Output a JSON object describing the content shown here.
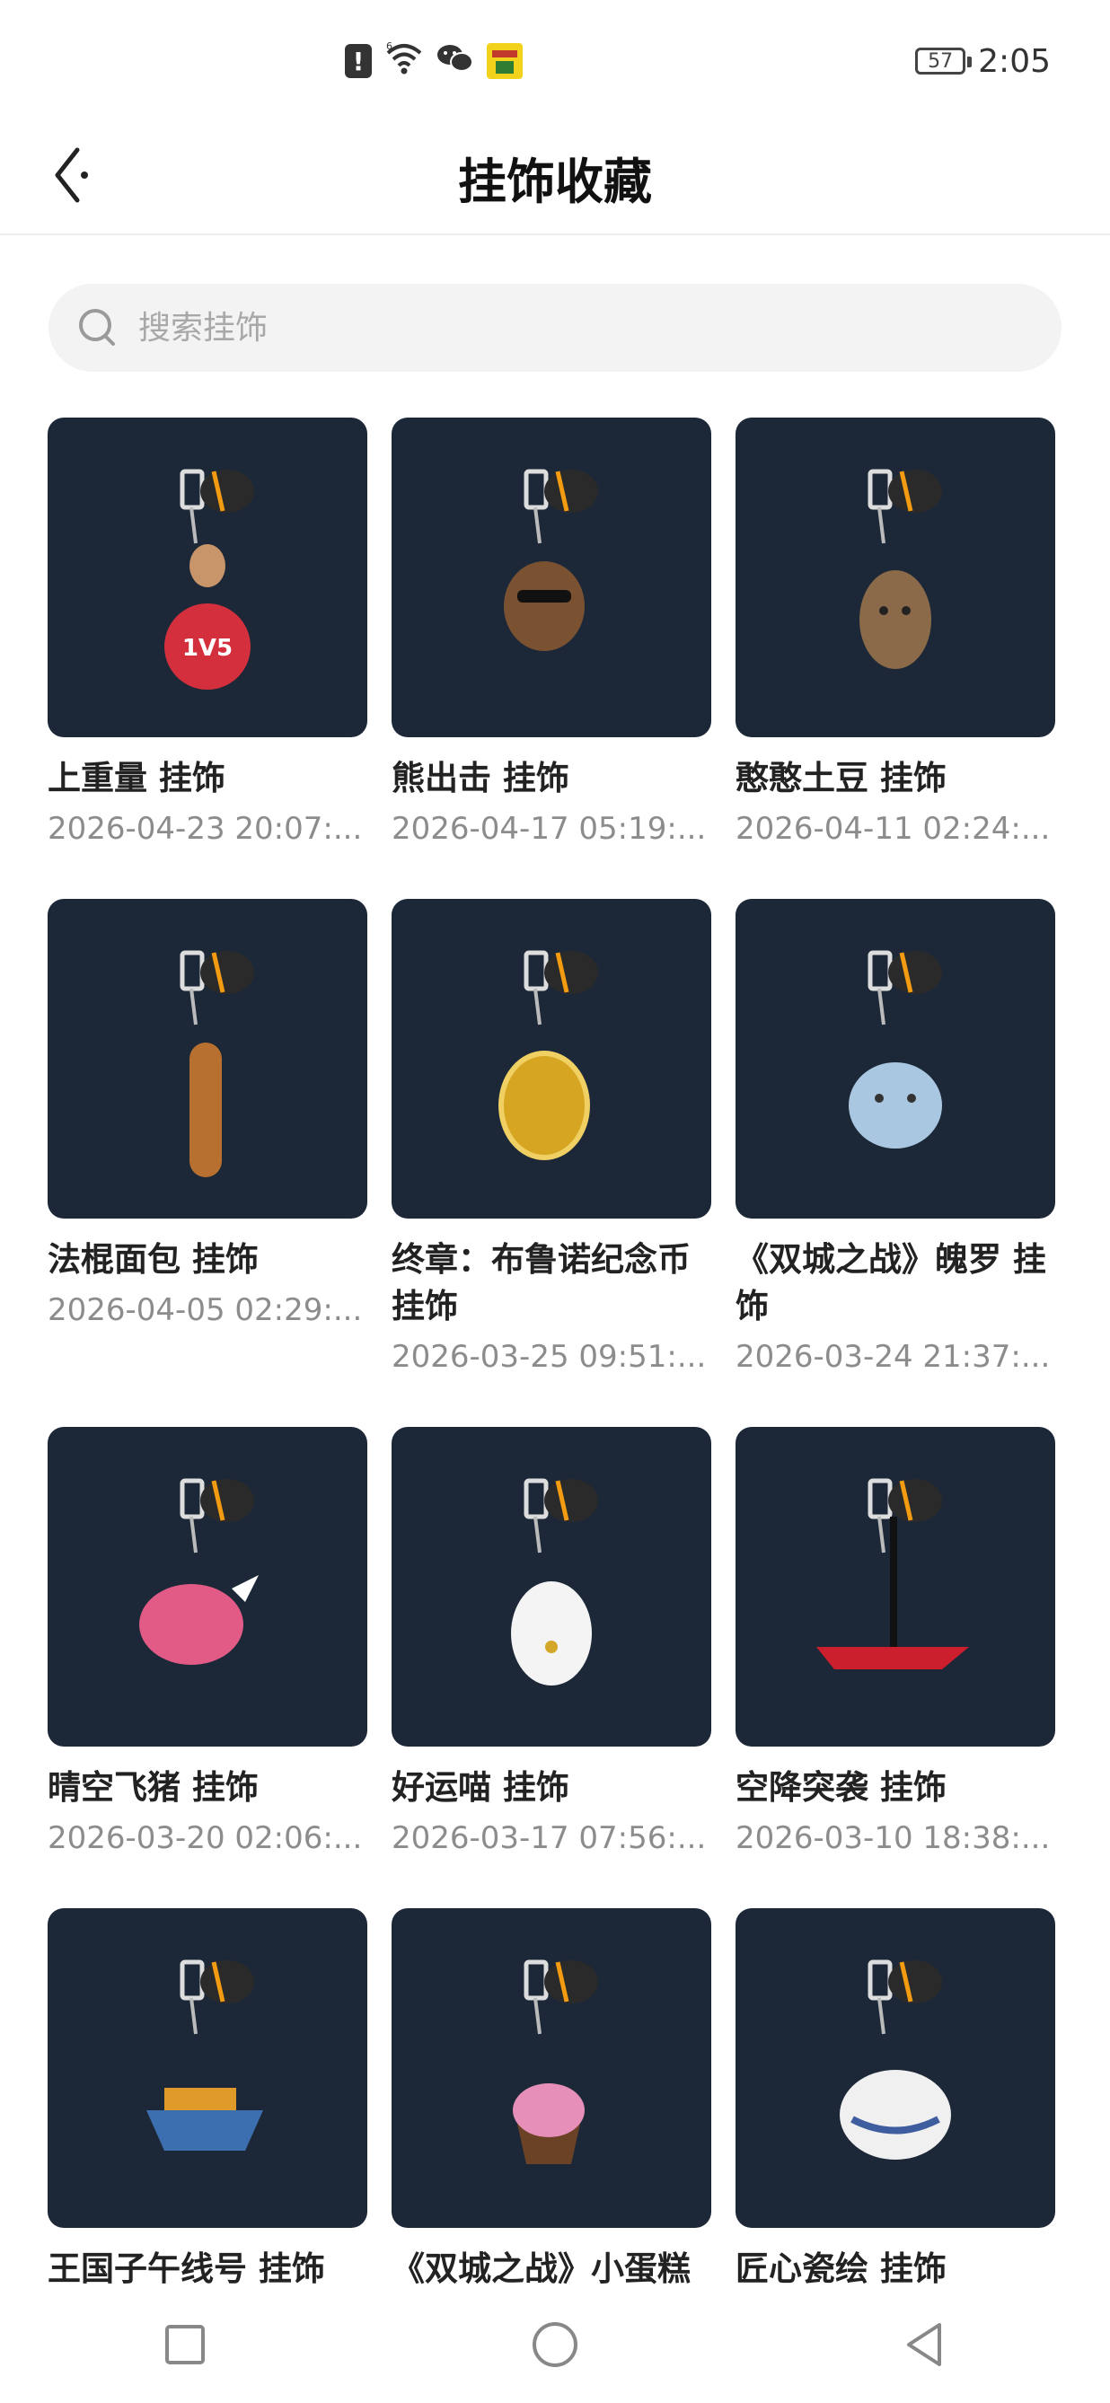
{
  "status_bar": {
    "alert_glyph": "!",
    "network_label": "6",
    "battery_level": "57",
    "time": "2:05"
  },
  "nav": {
    "title": "挂饰收藏"
  },
  "search": {
    "placeholder": "搜索挂饰",
    "value": ""
  },
  "items": [
    {
      "name": " 上重量 挂饰",
      "date": "2026-04-23 20:07:...",
      "icon": "kettlebell-charm",
      "accent": "#d32f3c"
    },
    {
      "name": "熊出击 挂饰",
      "date": "2026-04-17 05:19:...",
      "icon": "bear-charm",
      "accent": "#7a5231"
    },
    {
      "name": "憨憨土豆 挂饰",
      "date": "2026-04-11 02:24:...",
      "icon": "potato-charm",
      "accent": "#8a6a48"
    },
    {
      "name": "法棍面包 挂饰",
      "date": "2026-04-05 02:29:...",
      "icon": "baguette-charm",
      "accent": "#b7702f"
    },
    {
      "name": "终章：布鲁诺纪念币 挂饰",
      "date": "2026-03-25 09:51:...",
      "icon": "coin-charm",
      "accent": "#d6a521"
    },
    {
      "name": "《双城之战》魄罗 挂饰",
      "date": "2026-03-24 21:37:...",
      "icon": "poro-charm",
      "accent": "#a9c7e0"
    },
    {
      "name": "晴空飞猪 挂饰",
      "date": "2026-03-20 02:06:...",
      "icon": "flying-pig-charm",
      "accent": "#e25b86"
    },
    {
      "name": "好运喵 挂饰",
      "date": "2026-03-17 07:56:...",
      "icon": "lucky-cat-charm",
      "accent": "#f4f4f4"
    },
    {
      "name": "空降突袭 挂饰",
      "date": "2026-03-10 18:38:...",
      "icon": "airdrop-charm",
      "accent": "#cc1f2e"
    },
    {
      "name": "王国子午线号 挂饰",
      "date": "",
      "icon": "ship-charm",
      "accent": "#3c6fb0"
    },
    {
      "name": "《双城之战》小蛋糕",
      "date": "",
      "icon": "cupcake-charm",
      "accent": "#e68fb8"
    },
    {
      "name": "匠心瓷绘 挂饰",
      "date": "",
      "icon": "teapot-charm",
      "accent": "#3d5d9e"
    }
  ],
  "bottom_nav": {
    "recents_icon": "square-icon",
    "home_icon": "circle-icon",
    "back_icon": "triangle-back-icon"
  }
}
